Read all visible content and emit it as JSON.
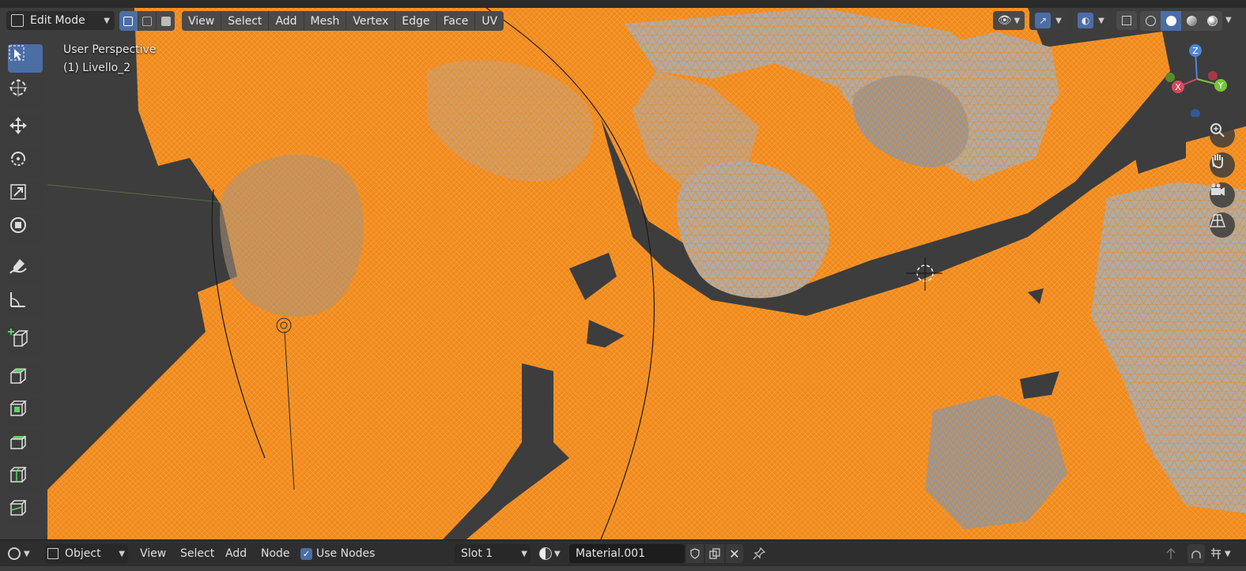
{
  "colors": {
    "selection_orange": "#ff8a12",
    "mesh_gray": "#b5aca2",
    "viewport_bg": "#3d3d3d",
    "header_bg": "#2b2b2b",
    "active_blue": "#4b6ea5"
  },
  "header": {
    "mode_label": "Edit Mode",
    "menus": [
      "View",
      "Select",
      "Add",
      "Mesh",
      "Vertex",
      "Edge",
      "Face",
      "UV"
    ],
    "select_modes": [
      "vertex-select-icon",
      "edge-select-icon",
      "face-select-icon"
    ],
    "right_icons": [
      "visibility-icon",
      "gizmo-icon",
      "overlay-icon",
      "xray-icon",
      "wireframe-shading-icon",
      "solid-shading-icon",
      "material-shading-icon",
      "rendered-shading-icon"
    ]
  },
  "viewport": {
    "view_name": "User Perspective",
    "object_info": "(1) Livello_2",
    "gizmo": {
      "z": "Z",
      "x": "X",
      "y": "Y"
    }
  },
  "toolbar": {
    "tools": [
      "select-box-icon",
      "cursor-icon",
      "move-icon",
      "rotate-icon",
      "scale-icon",
      "transform-icon",
      "annotate-icon",
      "measure-icon",
      "add-cube-icon",
      "extrude-icon",
      "inset-icon",
      "bevel-icon",
      "loop-cut-icon",
      "knife-icon"
    ]
  },
  "nav": [
    "zoom-icon",
    "pan-hand-icon",
    "camera-view-icon",
    "perspective-grid-icon"
  ],
  "footer": {
    "object_label": "Object",
    "view_label": "View",
    "select_label": "Select",
    "add_label": "Add",
    "node_label": "Node",
    "use_nodes_label": "Use Nodes",
    "use_nodes_checked": true,
    "slot_label": "Slot 1",
    "material_name": "Material.001"
  }
}
